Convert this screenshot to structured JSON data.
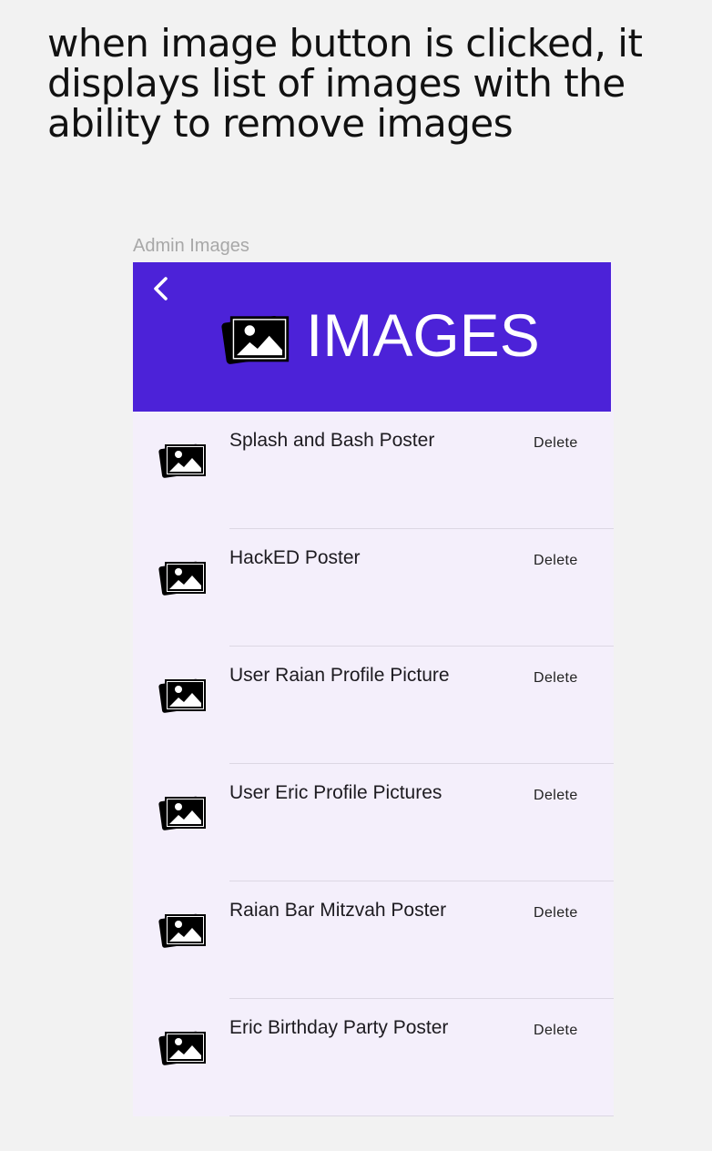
{
  "caption": "when image button is clicked, it displays list of images with the ability to remove images",
  "frame_label": "Admin Images",
  "header": {
    "back_icon": "chevron-left-icon",
    "icon": "images-icon",
    "title": "IMAGES",
    "background_color": "#4c22d8"
  },
  "list": {
    "item_icon": "images-icon",
    "items": [
      {
        "title": "Splash and Bash Poster",
        "action": "Delete"
      },
      {
        "title": "HackED Poster",
        "action": "Delete"
      },
      {
        "title": "User Raian Profile Picture",
        "action": "Delete"
      },
      {
        "title": "User Eric Profile Pictures",
        "action": "Delete"
      },
      {
        "title": "Raian Bar Mitzvah Poster",
        "action": "Delete"
      },
      {
        "title": "Eric Birthday Party Poster",
        "action": "Delete"
      }
    ]
  }
}
